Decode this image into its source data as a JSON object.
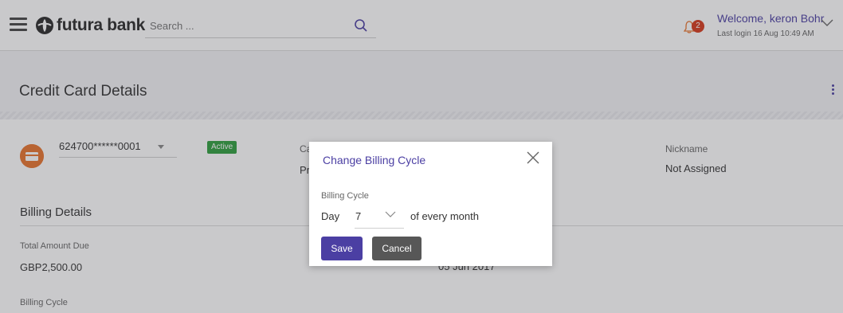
{
  "header": {
    "brand": "futura bank",
    "search_placeholder": "Search ...",
    "notification_count": "2",
    "welcome": "Welcome, keron Bohr",
    "last_login": "Last login 16 Aug 10:49 AM"
  },
  "page": {
    "title": "Credit Card Details"
  },
  "card": {
    "number": "624700******0001",
    "status": "Active",
    "partial_label": "Ca",
    "partial_value": "Pr",
    "partial_value_bottom": "05 Jun 2017",
    "nickname_label": "Nickname",
    "nickname_value": "Not Assigned"
  },
  "billing": {
    "heading": "Billing Details",
    "total_due_label": "Total Amount Due",
    "total_due_value": "GBP2,500.00",
    "cycle_label": "Billing Cycle"
  },
  "modal": {
    "title": "Change Billing Cycle",
    "field_label": "Billing Cycle",
    "day_prefix": "Day",
    "day_value": "7",
    "day_suffix": "of every month",
    "save_label": "Save",
    "cancel_label": "Cancel"
  },
  "colors": {
    "accent": "#4b3fa3",
    "card_icon": "#e8732d",
    "status_active": "#2f9e3e",
    "badge": "#d6391d"
  }
}
